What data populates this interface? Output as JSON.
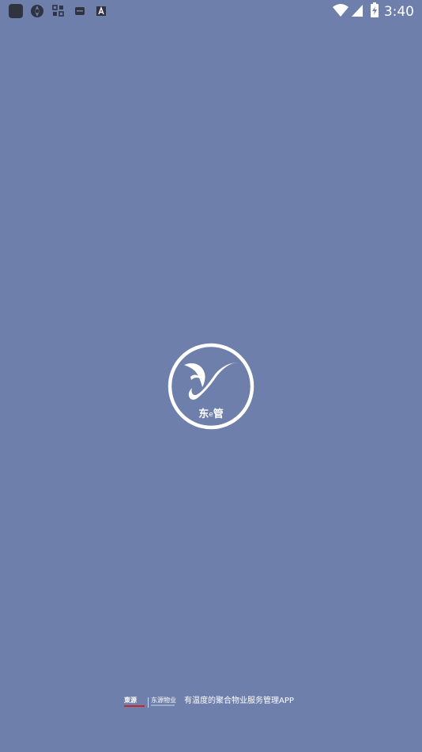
{
  "status_bar": {
    "time": "3:40",
    "left_icons": [
      "app-square-icon",
      "aperture-icon",
      "grid-apps-icon",
      "message-icon",
      "text-a-icon"
    ],
    "right_icons": [
      "wifi-icon",
      "cellular-signal-icon",
      "battery-charging-icon"
    ]
  },
  "splash": {
    "logo_char": "东",
    "logo_sup": "e",
    "logo_char2": "管"
  },
  "footer": {
    "brand_primary": "東源",
    "brand_secondary": "东源物业",
    "slogan": "有温度的聚合物业服务管理APP"
  },
  "colors": {
    "background": "#6e7fab",
    "foreground": "#ffffff",
    "brand_red": "#c62828"
  }
}
